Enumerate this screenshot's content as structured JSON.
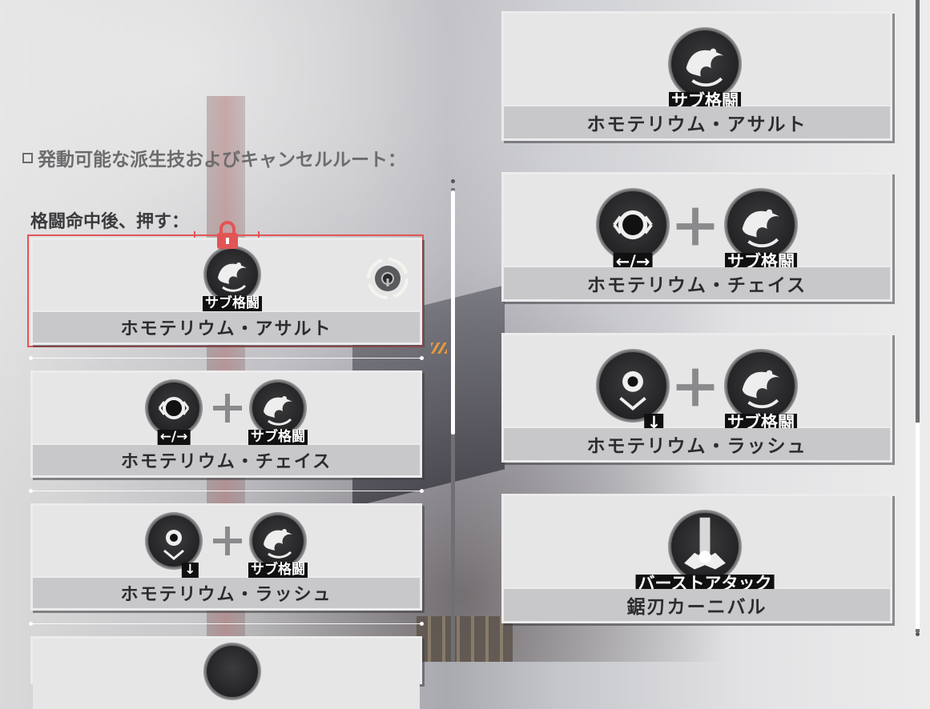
{
  "section_title": "発動可能な派生技およびキャンセルルート：",
  "subsection_label": "格闘命中後、押す：",
  "left_cards": [
    {
      "name": "ホモテリウム・アサルト",
      "inputs": [
        {
          "icon": "sub-melee-icon",
          "tag": "サブ格闘"
        }
      ],
      "locked": true,
      "selected": true
    },
    {
      "name": "ホモテリウム・チェイス",
      "inputs": [
        {
          "icon": "direction-left-right-icon",
          "tag": "←/→"
        },
        {
          "icon": "sub-melee-icon",
          "tag": "サブ格闘"
        }
      ]
    },
    {
      "name": "ホモテリウム・ラッシュ",
      "inputs": [
        {
          "icon": "direction-down-icon",
          "tag": "↓"
        },
        {
          "icon": "sub-melee-icon",
          "tag": "サブ格闘"
        }
      ]
    }
  ],
  "right_cards": [
    {
      "name": "ホモテリウム・アサルト",
      "inputs": [
        {
          "icon": "sub-melee-icon",
          "tag": "サブ格闘"
        }
      ]
    },
    {
      "name": "ホモテリウム・チェイス",
      "inputs": [
        {
          "icon": "direction-left-right-icon",
          "tag": "←/→"
        },
        {
          "icon": "sub-melee-icon",
          "tag": "サブ格闘"
        }
      ]
    },
    {
      "name": "ホモテリウム・ラッシュ",
      "inputs": [
        {
          "icon": "direction-down-icon",
          "tag": "↓"
        },
        {
          "icon": "sub-melee-icon",
          "tag": "サブ格闘"
        }
      ]
    },
    {
      "name": "鋸刃カーニバル",
      "inputs": [
        {
          "icon": "burst-attack-icon",
          "tag": "バーストアタック"
        }
      ]
    }
  ],
  "colors": {
    "highlight": "#e25555",
    "card_bg": "#ececed",
    "name_bar": "#c8c8ca"
  }
}
